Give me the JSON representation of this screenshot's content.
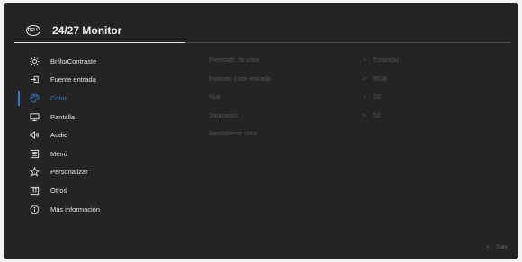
{
  "header": {
    "logo_text": "DELL",
    "title": "24/27 Monitor"
  },
  "menu": [
    {
      "label": "Brillo/Contraste",
      "icon": "brightness-icon"
    },
    {
      "label": "Fuente entrada",
      "icon": "input-source-icon"
    },
    {
      "label": "Color",
      "icon": "color-palette-icon",
      "active": true
    },
    {
      "label": "Pantalla",
      "icon": "display-icon"
    },
    {
      "label": "Audio",
      "icon": "speaker-icon"
    },
    {
      "label": "Menú",
      "icon": "menu-icon"
    },
    {
      "label": "Personalizar",
      "icon": "star-icon"
    },
    {
      "label": "Otros",
      "icon": "others-icon"
    },
    {
      "label": "Más información",
      "icon": "info-icon"
    }
  ],
  "options": [
    {
      "name": "Preestab. de color",
      "value": "Estándar"
    },
    {
      "name": "Formato color entrada",
      "value": "RGB"
    },
    {
      "name": "Hue",
      "value": "50"
    },
    {
      "name": "Saturación",
      "value": "50"
    },
    {
      "name": "Restablecer color",
      "value": ""
    }
  ],
  "footer": {
    "exit_label": "Salir",
    "exit_chevron": "<"
  },
  "colors": {
    "accent": "#2a7dcc",
    "background": "#242424",
    "disabled_text": "#555555"
  }
}
